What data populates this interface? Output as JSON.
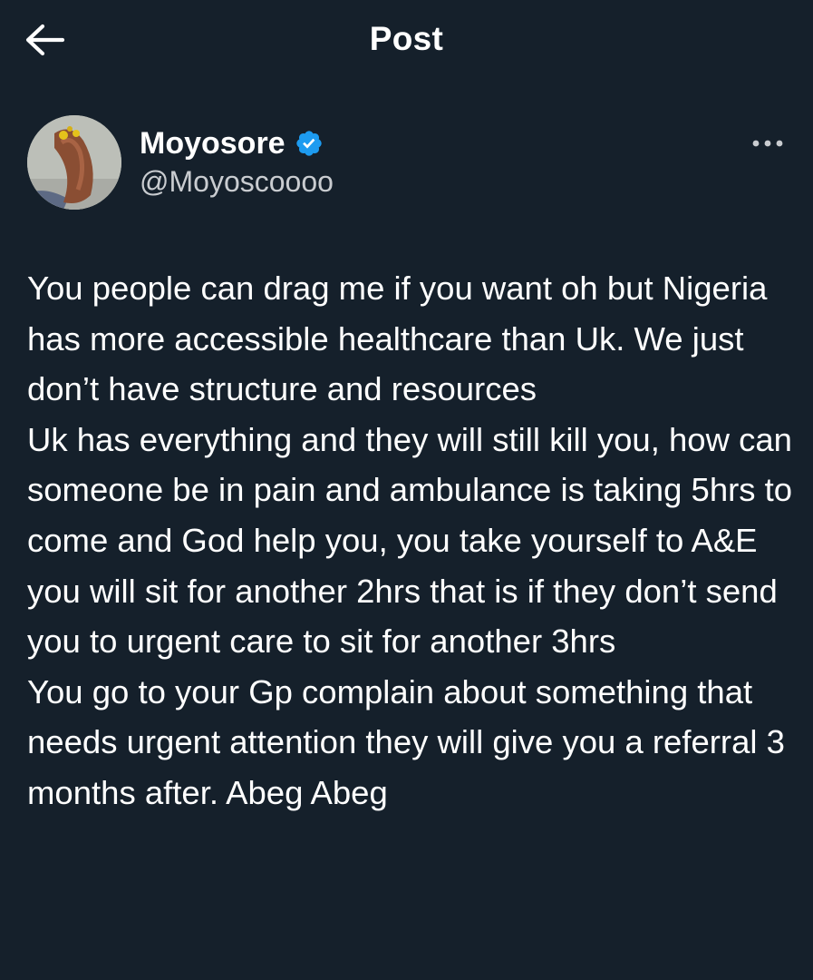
{
  "header": {
    "title": "Post",
    "back_icon": "arrow-left-icon"
  },
  "author": {
    "display_name": "Moyosore",
    "handle": "@Moyoscoooo",
    "verified": true,
    "verified_color": "#1d9bf0",
    "avatar_icon": "avatar-photo"
  },
  "post": {
    "text": "You people can drag me if you want oh but Nigeria has more accessible healthcare than Uk. We just don’t have structure and resources\nUk has everything and they will still kill you, how can someone be in pain and ambulance is taking 5hrs to come and God help you, you take yourself to A&E you will sit for another 2hrs that is if they don’t send you to urgent care to sit for another 3hrs\nYou go to your Gp complain about something that needs urgent attention they will give you a referral 3 months after. Abeg Abeg"
  },
  "theme": {
    "background": "#15202b",
    "text": "#ffffff",
    "secondary_text": "#c9ccd0"
  }
}
